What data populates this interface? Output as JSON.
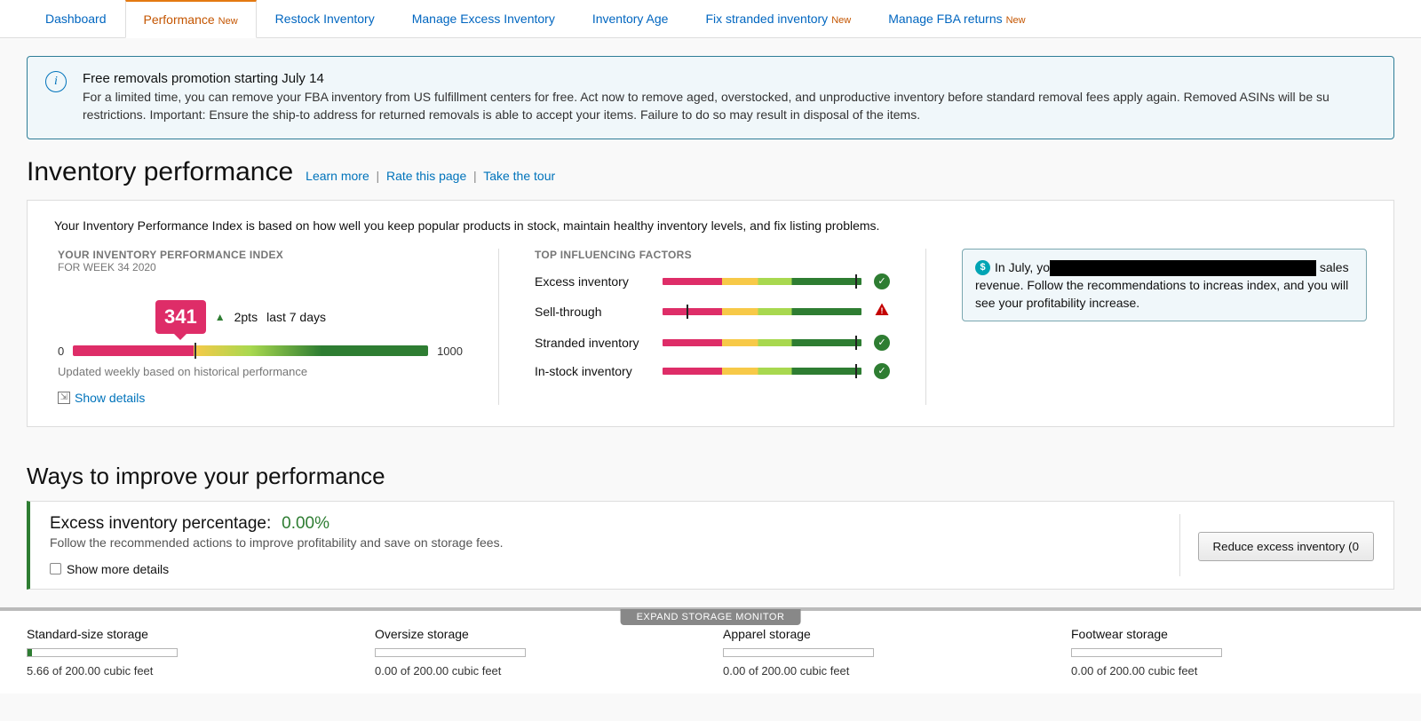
{
  "tabs": [
    {
      "label": "Dashboard",
      "new": false,
      "active": false
    },
    {
      "label": "Performance",
      "new": true,
      "active": true
    },
    {
      "label": "Restock Inventory",
      "new": false,
      "active": false
    },
    {
      "label": "Manage Excess Inventory",
      "new": false,
      "active": false
    },
    {
      "label": "Inventory Age",
      "new": false,
      "active": false
    },
    {
      "label": "Fix stranded inventory",
      "new": true,
      "active": false
    },
    {
      "label": "Manage FBA returns",
      "new": true,
      "active": false
    }
  ],
  "new_label": "New",
  "banner": {
    "title": "Free removals promotion starting July 14",
    "body": "For a limited time, you can remove your FBA inventory from US fulfillment centers for free. Act now to remove aged, overstocked, and unproductive inventory before standard removal fees apply again. Removed ASINs will be su restrictions. Important: Ensure the ship-to address for returned removals is able to accept your items. Failure to do so may result in disposal of the items."
  },
  "page": {
    "title": "Inventory performance",
    "learn": "Learn more",
    "rate": "Rate this page",
    "tour": "Take the tour"
  },
  "card_intro": "Your Inventory Performance Index is based on how well you keep popular products in stock, maintain healthy inventory levels, and fix listing problems.",
  "ipi": {
    "header": "YOUR INVENTORY PERFORMANCE INDEX",
    "sub": "FOR WEEK 34 2020",
    "score": "341",
    "change": "2pts",
    "period": "last 7 days",
    "min": "0",
    "max": "1000",
    "marker_pct": 34.1,
    "updated": "Updated weekly based on historical performance",
    "show_details": "Show details"
  },
  "factors": {
    "header": "TOP INFLUENCING FACTORS",
    "rows": [
      {
        "label": "Excess inventory",
        "marker_pct": 97,
        "status": "ok"
      },
      {
        "label": "Sell-through",
        "marker_pct": 12,
        "status": "warn"
      },
      {
        "label": "Stranded inventory",
        "marker_pct": 97,
        "status": "ok"
      },
      {
        "label": "In-stock inventory",
        "marker_pct": 97,
        "status": "ok"
      }
    ]
  },
  "tip": {
    "prefix": "In July, yo",
    "suffix": " sales revenue. Follow the recommendations to increas index, and you will see your profitability increase."
  },
  "improve_header": "Ways to improve your performance",
  "excess": {
    "title": "Excess inventory percentage:",
    "value": "0.00%",
    "desc": "Follow the recommended actions to improve profitability and save on storage fees.",
    "show_more": "Show more details",
    "button": "Reduce excess inventory (0"
  },
  "storage_monitor": "EXPAND STORAGE MONITOR",
  "storage": [
    {
      "label": "Standard-size storage",
      "text": "5.66 of 200.00 cubic feet",
      "fill_pct": 2.83
    },
    {
      "label": "Oversize storage",
      "text": "0.00 of 200.00 cubic feet",
      "fill_pct": 0
    },
    {
      "label": "Apparel storage",
      "text": "0.00 of 200.00 cubic feet",
      "fill_pct": 0
    },
    {
      "label": "Footwear storage",
      "text": "0.00 of 200.00 cubic feet",
      "fill_pct": 0
    }
  ]
}
